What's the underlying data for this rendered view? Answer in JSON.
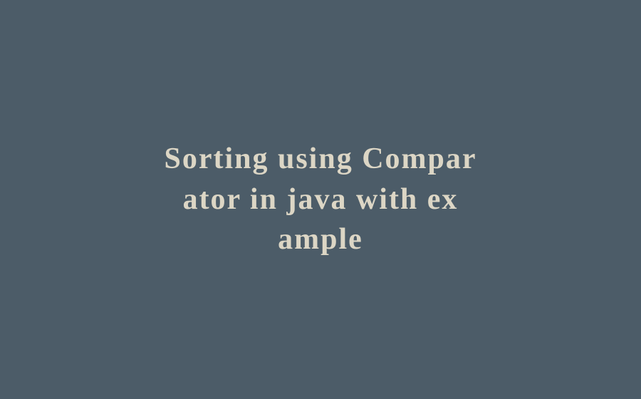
{
  "title": {
    "line1": "Sorting using Compar",
    "line2": "ator in java with ex",
    "line3": "ample"
  }
}
